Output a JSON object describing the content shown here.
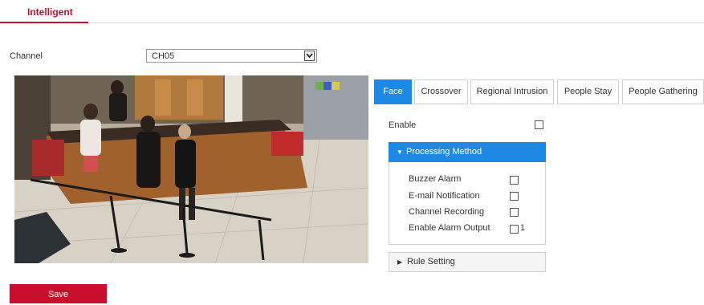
{
  "page_tab": {
    "label": "Intelligent"
  },
  "channel": {
    "label": "Channel",
    "value": "CH05"
  },
  "tabs": [
    {
      "label": "Face",
      "active": true
    },
    {
      "label": "Crossover",
      "active": false
    },
    {
      "label": "Regional Intrusion",
      "active": false
    },
    {
      "label": "People Stay",
      "active": false
    },
    {
      "label": "People Gathering",
      "active": false
    }
  ],
  "enable": {
    "label": "Enable",
    "checked": false
  },
  "processing": {
    "title": "Processing Method",
    "expanded": true,
    "options": [
      {
        "label": "Buzzer Alarm",
        "checked": false
      },
      {
        "label": "E-mail Notification",
        "checked": false
      },
      {
        "label": "Channel Recording",
        "checked": false
      },
      {
        "label": "Enable Alarm Output",
        "checked": false,
        "suffix": "1"
      }
    ]
  },
  "rule_setting": {
    "title": "Rule Setting",
    "expanded": false
  },
  "actions": {
    "save_label": "Save"
  },
  "colors": {
    "accent_red": "#c8102e",
    "accent_blue": "#1e88e5"
  }
}
